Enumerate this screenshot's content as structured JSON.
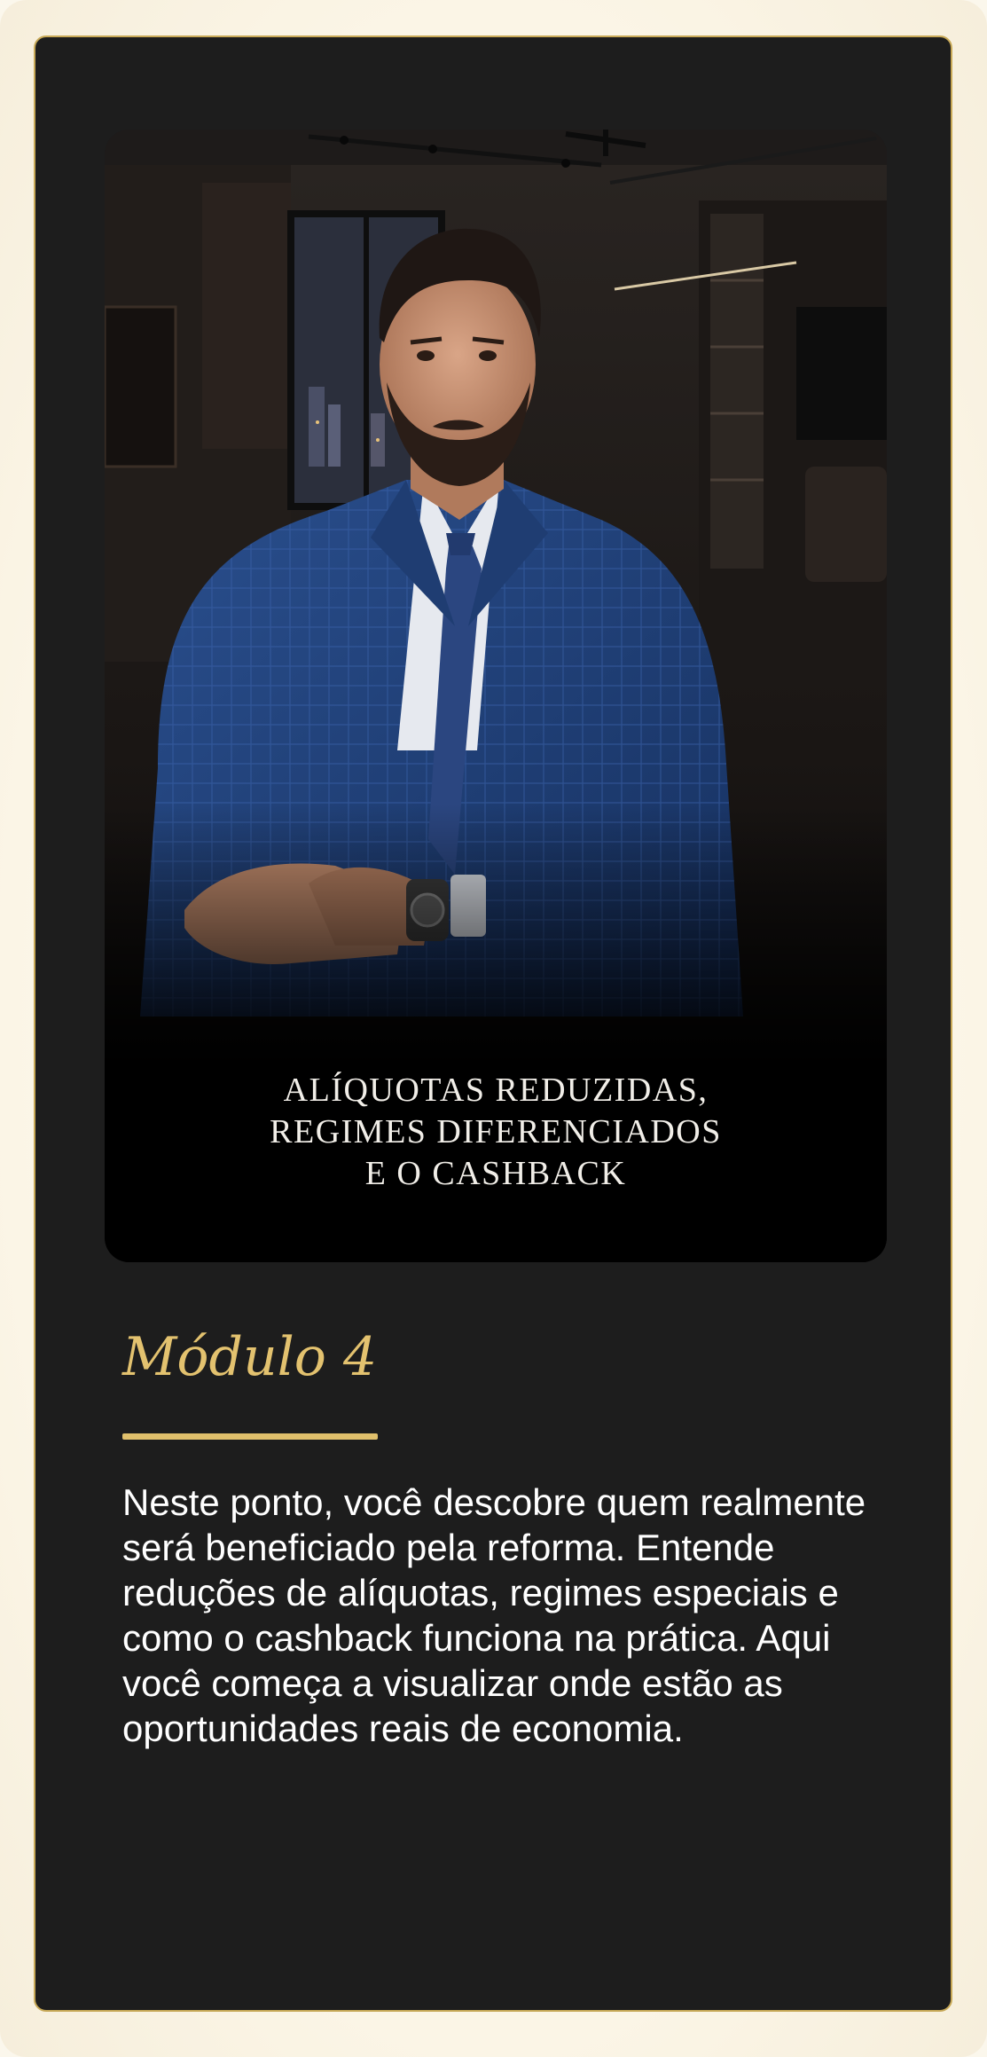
{
  "module": {
    "cover_image": {
      "icon": "portrait-photo",
      "title_lines": [
        "ALÍQUOTAS REDUZIDAS,",
        "REGIMES DIFERENCIADOS",
        "E O CASHBACK"
      ]
    },
    "heading": "Módulo 4",
    "description": "Neste ponto, você descobre quem realmente será beneficiado pela reforma. Entende reduções de alíquotas, regimes especiais e como o cashback funciona na prática. Aqui você começa a visualizar onde estão as oportunidades reais de economia."
  },
  "colors": {
    "card_background": "#1d1d1d",
    "page_background": "#fbf7ec",
    "accent_gold": "#e3c26f",
    "text_white": "#ffffff"
  }
}
